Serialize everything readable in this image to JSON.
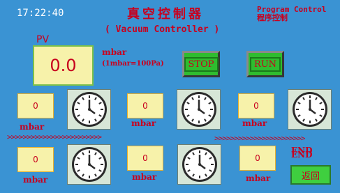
{
  "header": {
    "time": "17:22:40",
    "title": "真空控制器",
    "subtitle": "( Vacuum Controller )",
    "program_control_en": "Program Control",
    "program_control_cn": "程序控制"
  },
  "pv": {
    "label": "PV",
    "value": "0.0",
    "unit": "mbar",
    "note": "(1mbar=100Pa)"
  },
  "buttons": {
    "stop": "STOP",
    "run": "RUN",
    "return": "返回"
  },
  "row1": [
    {
      "value": "0",
      "unit": "mbar"
    },
    {
      "value": "0",
      "unit": "mbar"
    },
    {
      "value": "0",
      "unit": "mbar"
    }
  ],
  "row2": [
    {
      "value": "0",
      "unit": "mbar"
    },
    {
      "value": "0",
      "unit": "mbar"
    },
    {
      "value": "0",
      "unit": "mbar"
    }
  ],
  "arrows": {
    "left": ">>>>>>>>>>>>>>>>>>>>>>>>",
    "right": ">>>>>>>>>>>>>>>>>>>>>>>"
  },
  "end_label": "END",
  "colors": {
    "background": "#3a93d3",
    "accent_red": "#c8001e",
    "button_green": "#2fbc2f",
    "display_yellow": "#f7f2aa"
  },
  "icons": {
    "timer": "clock-icon"
  }
}
